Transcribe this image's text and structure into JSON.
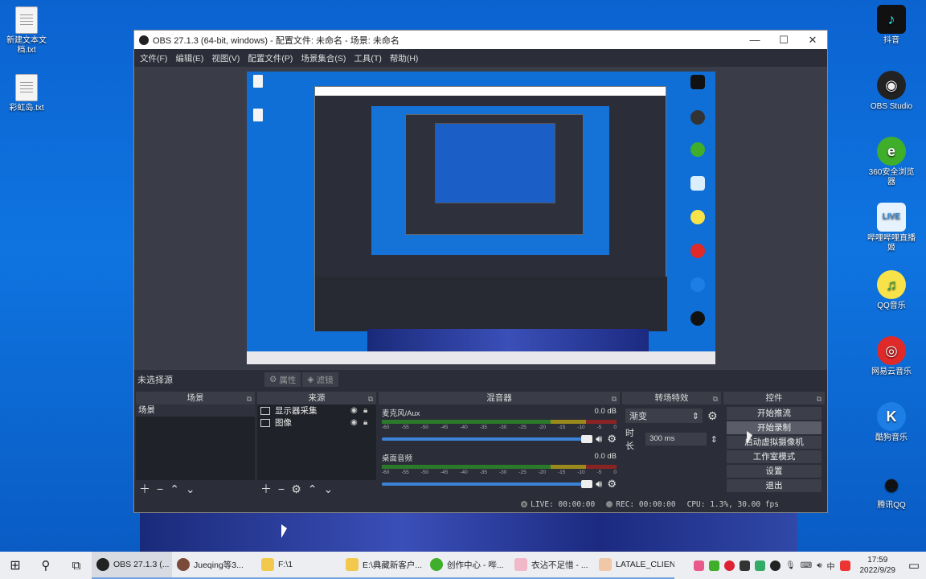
{
  "desktop": {
    "left_icons": [
      {
        "label": "新建文本文档.txt"
      },
      {
        "label": "彩虹岛.txt"
      }
    ],
    "right_icons": [
      {
        "label": "抖音",
        "icon": "douyin-icon",
        "color": "#111111"
      },
      {
        "label": "OBS Studio",
        "icon": "obs-icon",
        "color": "#222222"
      },
      {
        "label": "360安全浏览器",
        "icon": "browser-360-icon",
        "color": "#3fae2a"
      },
      {
        "label": "哔哩哔哩直播姬",
        "icon": "bilibili-live-icon",
        "color": "#e6f3ff"
      },
      {
        "label": "QQ音乐",
        "icon": "qq-music-icon",
        "color": "#f7e24a"
      },
      {
        "label": "网易云音乐",
        "icon": "netease-music-icon",
        "color": "#e02a2a"
      },
      {
        "label": "酷狗音乐",
        "icon": "kugou-icon",
        "color": "#1d7fe6"
      },
      {
        "label": "腾讯QQ",
        "icon": "qq-icon",
        "color": "#1a1a1a"
      }
    ]
  },
  "obs": {
    "title": "OBS 27.1.3 (64-bit, windows) - 配置文件: 未命名 - 场景: 未命名",
    "menu": [
      "文件(F)",
      "编辑(E)",
      "视图(V)",
      "配置文件(P)",
      "场景集合(S)",
      "工具(T)",
      "帮助(H)"
    ],
    "context_bar": {
      "no_source": "未选择源",
      "properties": "属性",
      "filters": "滤镜"
    },
    "scenes": {
      "title": "场景",
      "items": [
        "场景"
      ]
    },
    "sources": {
      "title": "来源",
      "items": [
        {
          "name": "显示器采集",
          "icon": "monitor-icon"
        },
        {
          "name": "图像",
          "icon": "image-icon"
        }
      ]
    },
    "mixer": {
      "title": "混音器",
      "channels": [
        {
          "name": "麦克风/Aux",
          "db": "0.0 dB",
          "volume_fraction": 1.0
        },
        {
          "name": "桌面音频",
          "db": "0.0 dB",
          "volume_fraction": 1.0
        }
      ],
      "scale": [
        "-60",
        "-55",
        "-50",
        "-45",
        "-40",
        "-35",
        "-30",
        "-25",
        "-20",
        "-15",
        "-10",
        "-5",
        "0"
      ]
    },
    "transitions": {
      "title": "转场特效",
      "selected": "渐变",
      "duration_label": "时长",
      "duration_value": "300 ms"
    },
    "controls": {
      "title": "控件",
      "buttons": [
        "开始推流",
        "开始录制",
        "启动虚拟摄像机",
        "工作室模式",
        "设置",
        "退出"
      ]
    },
    "status": {
      "live": "LIVE: 00:00:00",
      "rec": "REC: 00:00:00",
      "cpu": "CPU: 1.3%, 30.00 fps"
    }
  },
  "taskbar": {
    "apps": [
      {
        "label": "OBS 27.1.3 (...",
        "color": "#222222",
        "active": true
      },
      {
        "label": "Jueqing等3...",
        "color": "#7a4a3a"
      },
      {
        "label": "F:\\1",
        "color": "#f2c94c"
      },
      {
        "label": "E:\\典藏新客户...",
        "color": "#f2c94c"
      },
      {
        "label": "创作中心 - 哔...",
        "color": "#3fae2a"
      },
      {
        "label": "衣沾不足惜 - ...",
        "color": "#f0b8c8"
      },
      {
        "label": "LATALE_CLIEN",
        "color": "#f0c8a8"
      }
    ],
    "tray_lang": "中",
    "time": "17:59",
    "date": "2022/9/29"
  }
}
